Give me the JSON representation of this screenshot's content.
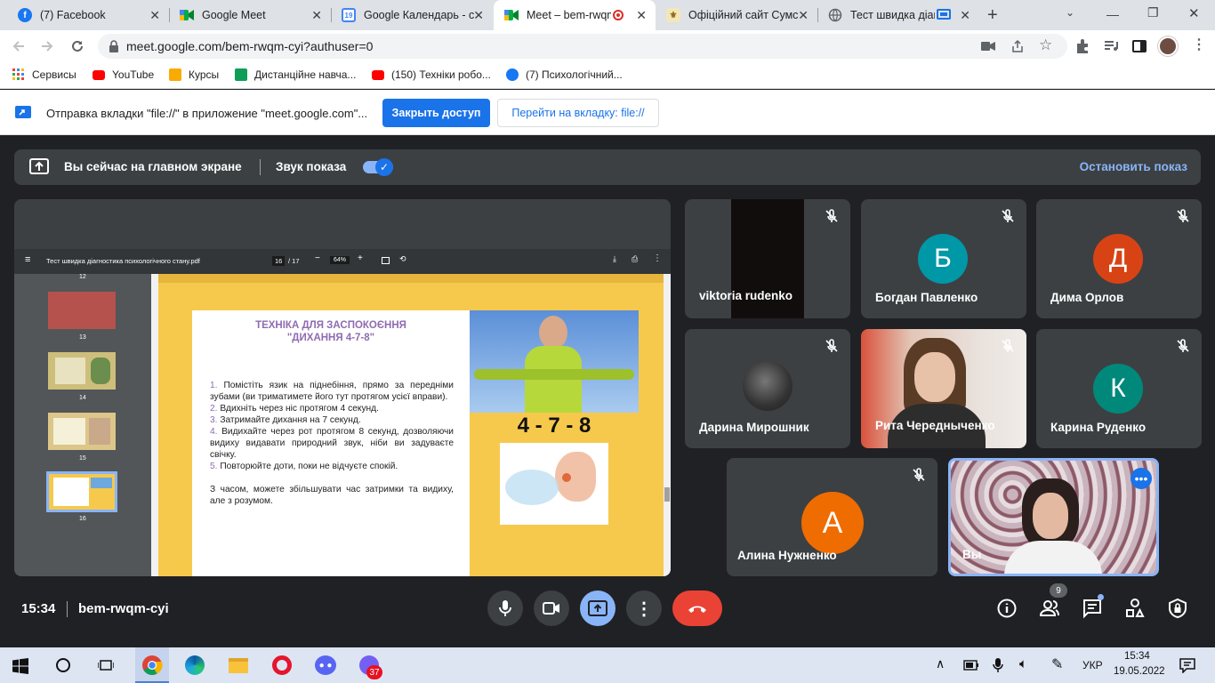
{
  "tabs": [
    {
      "title": "(7) Facebook",
      "icon": "facebook-icon",
      "color": "#1877f2",
      "glyph": "f"
    },
    {
      "title": "Google Meet",
      "icon": "meet-icon",
      "color": "#00897b",
      "glyph": ""
    },
    {
      "title": "Google Календарь - с",
      "icon": "calendar-icon",
      "color": "#4285f4",
      "glyph": "19"
    },
    {
      "title": "Meet – bem-rwqm",
      "icon": "meet-icon",
      "color": "#00897b",
      "glyph": ""
    },
    {
      "title": "Офіційний сайт Сумс",
      "icon": "crest-icon",
      "color": "#c9a13b",
      "glyph": ""
    },
    {
      "title": "Тест швидка діаг",
      "icon": "globe-icon",
      "color": "#5f6368",
      "glyph": ""
    }
  ],
  "address": {
    "url": "meet.google.com/bem-rwqm-cyi?authuser=0"
  },
  "bookmarks": [
    {
      "label": "Сервисы",
      "color": "#ea4335"
    },
    {
      "label": "YouTube",
      "color": "#ff0000"
    },
    {
      "label": "Курсы",
      "color": "#0f9d58"
    },
    {
      "label": "Дистанційне навча...",
      "color": "#0f9d58"
    },
    {
      "label": "(150) Техніки робо...",
      "color": "#ff0000"
    },
    {
      "label": "(7) Психологічний...",
      "color": "#1877f2"
    }
  ],
  "infobar": {
    "message": "Отправка вкладки \"file://\" в приложение \"meet.google.com\"...",
    "primary": "Закрыть доступ",
    "secondary": "Перейти на вкладку: file://"
  },
  "presenting": {
    "status": "Вы сейчас на главном экране",
    "sound": "Звук показа",
    "stop": "Остановить показ"
  },
  "pdf": {
    "filename": "Тест швидка діагностика психологічного стану.pdf",
    "page": "16",
    "total": "/ 17",
    "zoom": "64%",
    "thumbs": [
      "12",
      "13",
      "14",
      "15",
      "16"
    ],
    "slide_title": "ТЕХНІКА ДЛЯ ЗАСПОКОЄННЯ\n\"ДИХАННЯ 4-7-8\"",
    "steps": [
      {
        "num": "1.",
        "text": " Помістіть язик на піднебіння, прямо за передніми зубами (ви триматимете його тут протягом усієї вправи)."
      },
      {
        "num": "2.",
        "text": " Вдихніть через ніс протягом 4 секунд."
      },
      {
        "num": "3.",
        "text": " Затримайте дихання на 7 секунд."
      },
      {
        "num": "4.",
        "text": " Видихайте через рот протягом 8 секунд, дозволяючи видиху видавати природний звук, ніби ви задуваєте свічку."
      },
      {
        "num": "5.",
        "text": " Повторюйте доти, поки не відчуєте спокій."
      }
    ],
    "note": "З часом, можете збільшувати час затримки та видиху, але з розумом.",
    "big": "4 - 7 - 8"
  },
  "participants": [
    {
      "name": "viktoria rudenko",
      "initial": "",
      "color": ""
    },
    {
      "name": "Богдан Павленко",
      "initial": "Б",
      "color": "#0097a7"
    },
    {
      "name": "Дима Орлов",
      "initial": "Д",
      "color": "#d84315"
    },
    {
      "name": "Дарина Мирошник",
      "initial": "",
      "color": ""
    },
    {
      "name": "Рита Чередныченко",
      "initial": "",
      "color": ""
    },
    {
      "name": "Карина Руденко",
      "initial": "К",
      "color": "#00897b"
    },
    {
      "name": "Алина Нужненко",
      "initial": "А",
      "color": "#ef6c00"
    },
    {
      "name": "Вы",
      "initial": "",
      "color": ""
    }
  ],
  "footer": {
    "time": "15:34",
    "code": "bem-rwqm-cyi",
    "people_count": "9"
  },
  "taskbar": {
    "lang": "УКР",
    "time": "15:34",
    "date": "19.05.2022",
    "badge": "37"
  }
}
